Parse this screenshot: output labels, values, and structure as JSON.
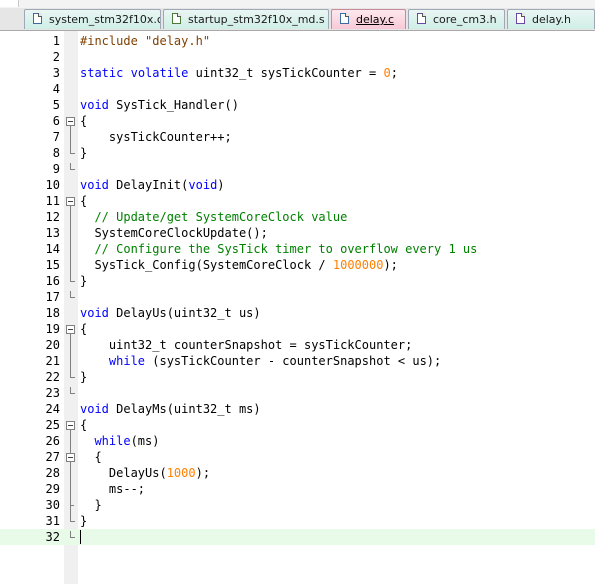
{
  "tabs": [
    {
      "label": "system_stm32f10x.c",
      "icon": "c-file-icon",
      "active": false
    },
    {
      "label": "startup_stm32f10x_md.s",
      "icon": "asm-file-icon",
      "active": false
    },
    {
      "label": "delay.c",
      "icon": "c-file-icon",
      "active": true
    },
    {
      "label": "core_cm3.h",
      "icon": "header-file-icon",
      "active": false
    },
    {
      "label": "delay.h",
      "icon": "header-file-icon",
      "active": false
    }
  ],
  "editor": {
    "current_line": 32,
    "lines": [
      {
        "n": "1",
        "tokens": [
          [
            "pp",
            "#include \"delay.h\""
          ]
        ]
      },
      {
        "n": "2",
        "tokens": []
      },
      {
        "n": "3",
        "tokens": [
          [
            "kw",
            "static"
          ],
          [
            "",
            " "
          ],
          [
            "kw",
            "volatile"
          ],
          [
            "",
            " uint32_t sysTickCounter = "
          ],
          [
            "num",
            "0"
          ],
          [
            "",
            ";"
          ]
        ]
      },
      {
        "n": "4",
        "tokens": []
      },
      {
        "n": "5",
        "tokens": [
          [
            "kw",
            "void"
          ],
          [
            "",
            " SysTick_Handler()"
          ]
        ]
      },
      {
        "n": "6",
        "tokens": [
          [
            "",
            "{"
          ]
        ]
      },
      {
        "n": "7",
        "tokens": [
          [
            "",
            "    sysTickCounter++;"
          ]
        ]
      },
      {
        "n": "8",
        "tokens": [
          [
            "",
            "}"
          ]
        ]
      },
      {
        "n": "9",
        "tokens": []
      },
      {
        "n": "10",
        "tokens": [
          [
            "kw",
            "void"
          ],
          [
            "",
            " DelayInit("
          ],
          [
            "kw",
            "void"
          ],
          [
            "",
            ")"
          ]
        ]
      },
      {
        "n": "11",
        "tokens": [
          [
            "",
            "{"
          ]
        ]
      },
      {
        "n": "12",
        "tokens": [
          [
            "",
            "  "
          ],
          [
            "cm",
            "// Update/get SystemCoreClock value"
          ]
        ]
      },
      {
        "n": "13",
        "tokens": [
          [
            "",
            "  SystemCoreClockUpdate();"
          ]
        ]
      },
      {
        "n": "14",
        "tokens": [
          [
            "",
            "  "
          ],
          [
            "cm",
            "// Configure the SysTick timer to overflow every 1 us"
          ]
        ]
      },
      {
        "n": "15",
        "tokens": [
          [
            "",
            "  SysTick_Config(SystemCoreClock / "
          ],
          [
            "num",
            "1000000"
          ],
          [
            "",
            ");"
          ]
        ]
      },
      {
        "n": "16",
        "tokens": [
          [
            "",
            "}"
          ]
        ]
      },
      {
        "n": "17",
        "tokens": []
      },
      {
        "n": "18",
        "tokens": [
          [
            "kw",
            "void"
          ],
          [
            "",
            " DelayUs(uint32_t us)"
          ]
        ]
      },
      {
        "n": "19",
        "tokens": [
          [
            "",
            "{"
          ]
        ]
      },
      {
        "n": "20",
        "tokens": [
          [
            "",
            "    uint32_t counterSnapshot = sysTickCounter;"
          ]
        ]
      },
      {
        "n": "21",
        "tokens": [
          [
            "",
            "    "
          ],
          [
            "kw",
            "while"
          ],
          [
            "",
            " (sysTickCounter - counterSnapshot < us);"
          ]
        ]
      },
      {
        "n": "22",
        "tokens": [
          [
            "",
            "}"
          ]
        ]
      },
      {
        "n": "23",
        "tokens": []
      },
      {
        "n": "24",
        "tokens": [
          [
            "kw",
            "void"
          ],
          [
            "",
            " DelayMs(uint32_t ms)"
          ]
        ]
      },
      {
        "n": "25",
        "tokens": [
          [
            "",
            "{"
          ]
        ]
      },
      {
        "n": "26",
        "tokens": [
          [
            "",
            "  "
          ],
          [
            "kw",
            "while"
          ],
          [
            "",
            "(ms)"
          ]
        ]
      },
      {
        "n": "27",
        "tokens": [
          [
            "",
            "  {"
          ]
        ]
      },
      {
        "n": "28",
        "tokens": [
          [
            "",
            "    DelayUs("
          ],
          [
            "num",
            "1000"
          ],
          [
            "",
            ");"
          ]
        ]
      },
      {
        "n": "29",
        "tokens": [
          [
            "",
            "    ms--;"
          ]
        ]
      },
      {
        "n": "30",
        "tokens": [
          [
            "",
            "  }"
          ]
        ]
      },
      {
        "n": "31",
        "tokens": [
          [
            "",
            "}"
          ]
        ]
      },
      {
        "n": "32",
        "tokens": []
      }
    ]
  },
  "colors": {
    "keyword": "#0000ff",
    "preprocessor": "#804000",
    "comment": "#008000",
    "number": "#ff8000",
    "current_line": "#e8fbe8"
  }
}
